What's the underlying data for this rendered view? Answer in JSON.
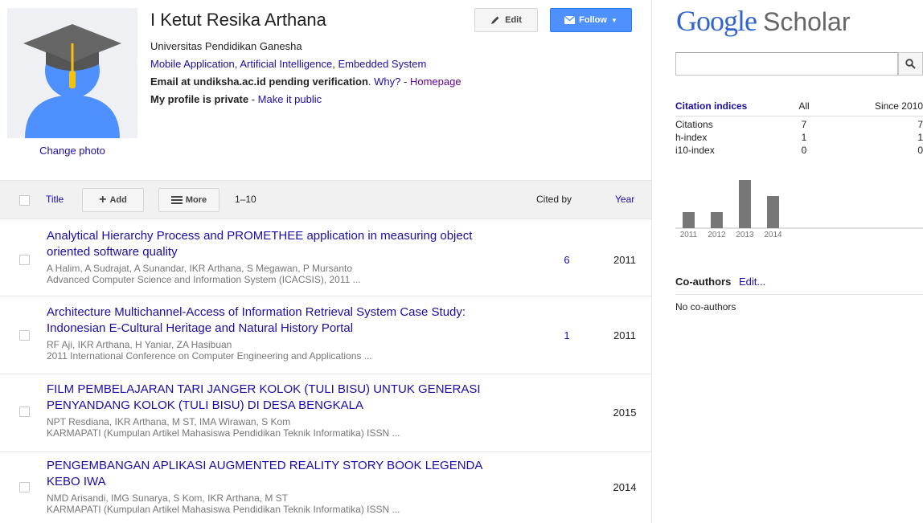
{
  "profile": {
    "name": "I Ketut Resika Arthana",
    "affiliation": "Universitas Pendidikan Ganesha",
    "interests": [
      "Mobile Application",
      "Artificial Intelligence",
      "Embedded System"
    ],
    "interest_sep": ", ",
    "email_text": "Email at undiksha.ac.id pending verification",
    "email_period": ".",
    "why_link": "Why?",
    "dash": " - ",
    "homepage_link": "Homepage",
    "private_text": "My profile is private",
    "make_public_link": "Make it public",
    "change_photo": "Change photo"
  },
  "header_buttons": {
    "edit": "Edit",
    "follow": "Follow"
  },
  "toolbar": {
    "title": "Title",
    "add": "Add",
    "more": "More",
    "range": "1–10",
    "cited_by": "Cited by",
    "year": "Year"
  },
  "articles": [
    {
      "title": "Analytical Hierarchy Process and PROMETHEE application in measuring object oriented software quality",
      "authors": "A Halim, A Sudrajat, A Sunandar, IKR Arthana, S Megawan, P Mursanto",
      "venue": "Advanced Computer Science and Information System (ICACSIS), 2011 ...",
      "cited_by": "6",
      "year": "2011"
    },
    {
      "title": "Architecture Multichannel-Access of Information Retrieval System Case Study: Indonesian E-Cultural Heritage and Natural History Portal",
      "authors": "RF Aji, IKR Arthana, H Yaniar, ZA Hasibuan",
      "venue": "2011 International Conference on Computer Engineering and Applications ...",
      "cited_by": "1",
      "year": "2011"
    },
    {
      "title": "FILM PEMBELAJARAN TARI JANGER KOLOK (TULI BISU) UNTUK GENERASI PENYANDANG KOLOK (TULI BISU) DI DESA BENGKALA",
      "authors": "NPT Resdiana, IKR Arthana, M ST, IMA Wirawan, S Kom",
      "venue": "KARMAPATI (Kumpulan Artikel Mahasiswa Pendidikan Teknik Informatika) ISSN ...",
      "cited_by": "",
      "year": "2015"
    },
    {
      "title": "PENGEMBANGAN APLIKASI AUGMENTED REALITY STORY BOOK LEGENDA KEBO IWA",
      "authors": "NMD Arisandi, IMG Sunarya, S Kom, IKR Arthana, M ST",
      "venue": "KARMAPATI (Kumpulan Artikel Mahasiswa Pendidikan Teknik Informatika) ISSN ...",
      "cited_by": "",
      "year": "2014"
    }
  ],
  "sidebar": {
    "logo_google": "Google",
    "logo_scholar": "Scholar",
    "search_placeholder": "",
    "citation_header": "Citation indices",
    "col_all": "All",
    "col_since": "Since 2010",
    "rows": [
      {
        "label": "Citations",
        "all": "7",
        "since": "7"
      },
      {
        "label": "h-index",
        "all": "1",
        "since": "1"
      },
      {
        "label": "i10-index",
        "all": "0",
        "since": "0"
      }
    ],
    "coauthors_title": "Co-authors",
    "coauthors_edit": "Edit...",
    "coauthors_none": "No co-authors"
  },
  "chart_data": {
    "type": "bar",
    "categories": [
      "2011",
      "2012",
      "2013",
      "2014"
    ],
    "values": [
      1,
      1,
      3,
      2
    ],
    "ylim": [
      0,
      3
    ]
  },
  "colors": {
    "link": "#1a0dab",
    "follow_bg": "#4d90fe",
    "bar": "#777777"
  }
}
